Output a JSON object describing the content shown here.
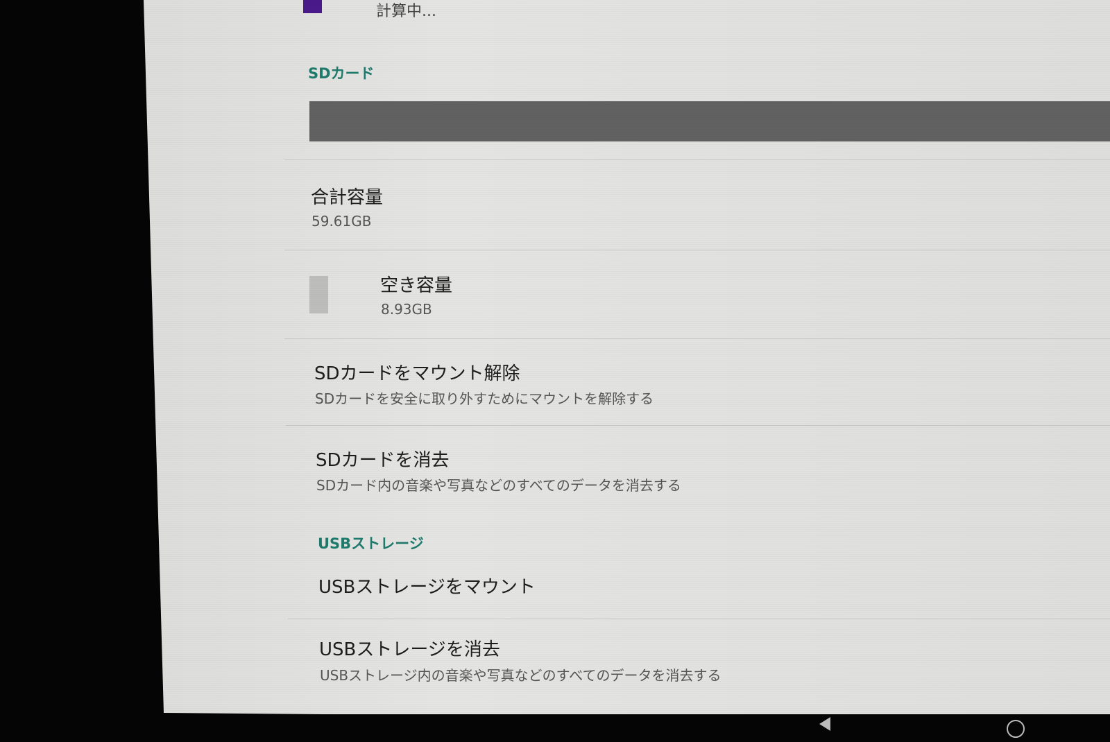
{
  "top_item": {
    "legend_color": "#4a1a8a",
    "status": "計算中..."
  },
  "sd_card": {
    "header": "SDカード",
    "usage_bar_color": "#616161",
    "total": {
      "label": "合計容量",
      "value": "59.61GB"
    },
    "free": {
      "label": "空き容量",
      "value": "8.93GB",
      "legend_color": "#bdbdbb"
    },
    "unmount": {
      "title": "SDカードをマウント解除",
      "summary": "SDカードを安全に取り外すためにマウントを解除する"
    },
    "erase": {
      "title": "SDカードを消去",
      "summary": "SDカード内の音楽や写真などのすべてのデータを消去する"
    }
  },
  "usb_storage": {
    "header": "USBストレージ",
    "mount": {
      "title": "USBストレージをマウント"
    },
    "erase": {
      "title": "USBストレージを消去",
      "summary": "USBストレージ内の音楽や写真などのすべてのデータを消去する"
    }
  },
  "nav_bar": {
    "icons": [
      "back-icon",
      "home-icon"
    ]
  }
}
